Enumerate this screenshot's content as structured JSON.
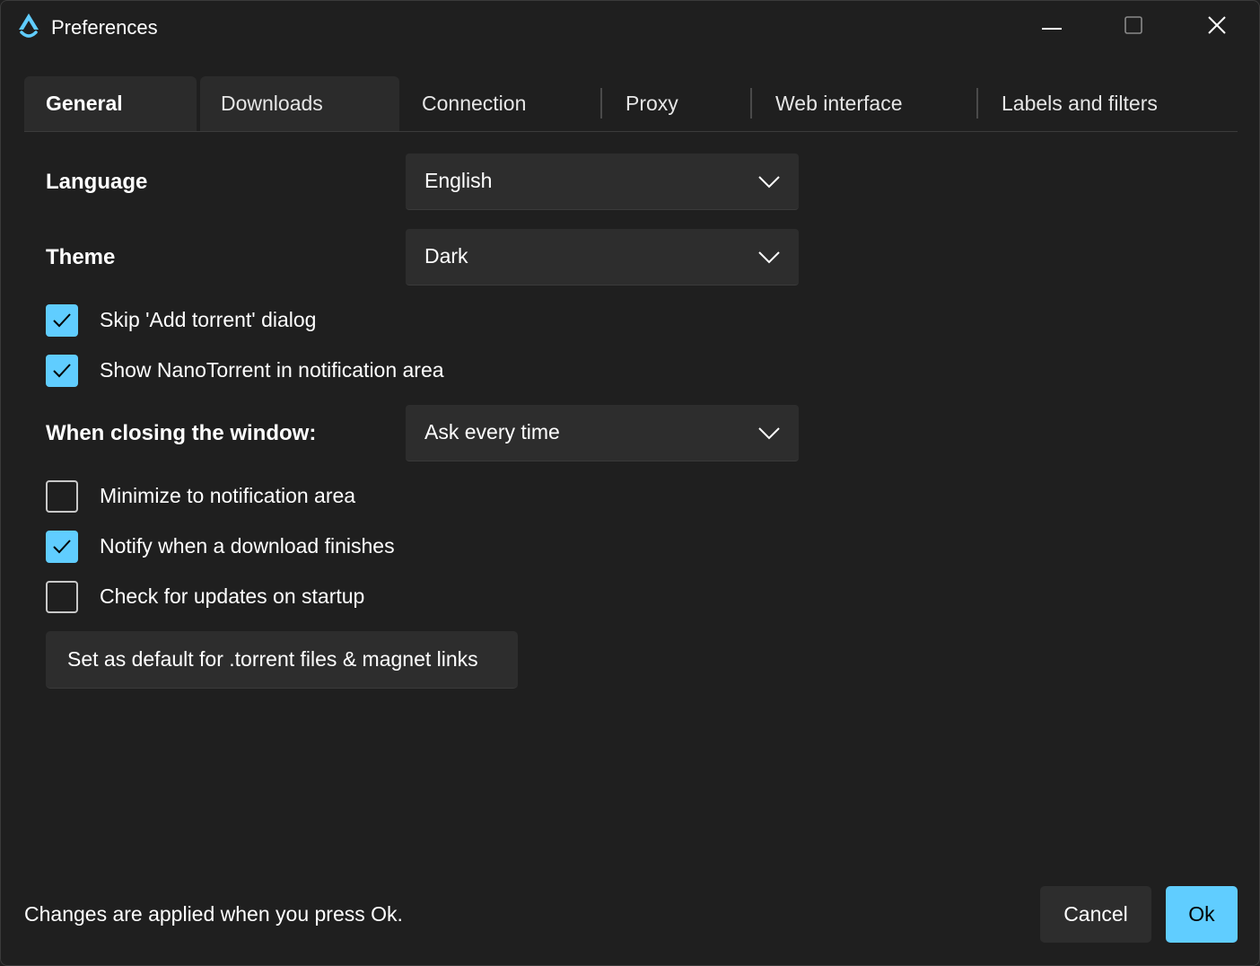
{
  "window": {
    "title": "Preferences",
    "app_icon": "nanotorrent-logo-icon",
    "controls": [
      "minimize-icon",
      "maximize-icon",
      "close-icon"
    ]
  },
  "tabs": [
    {
      "label": "General",
      "selected": true
    },
    {
      "label": "Downloads",
      "selected": false
    },
    {
      "label": "Connection",
      "selected": false
    },
    {
      "label": "Proxy",
      "selected": false
    },
    {
      "label": "Web interface",
      "selected": false
    },
    {
      "label": "Labels and filters",
      "selected": false
    }
  ],
  "general": {
    "language_label": "Language",
    "language_value": "English",
    "theme_label": "Theme",
    "theme_value": "Dark",
    "skip_add_torrent": {
      "label": "Skip 'Add torrent' dialog",
      "checked": true
    },
    "show_in_tray": {
      "label": "Show NanoTorrent in notification area",
      "checked": true
    },
    "closing_label": "When closing the window:",
    "closing_value": "Ask every time",
    "minimize_to_tray": {
      "label": "Minimize to notification area",
      "checked": false
    },
    "notify_download": {
      "label": "Notify when a download finishes",
      "checked": true
    },
    "check_updates": {
      "label": "Check for updates on startup",
      "checked": false
    },
    "set_default_label": "Set as default for .torrent files & magnet links"
  },
  "footer": {
    "note": "Changes are applied when you press Ok.",
    "cancel_label": "Cancel",
    "ok_label": "Ok"
  },
  "colors": {
    "accent": "#60cdff",
    "background": "#1f1f1f",
    "control": "#2d2d2d",
    "text": "#ffffff"
  }
}
